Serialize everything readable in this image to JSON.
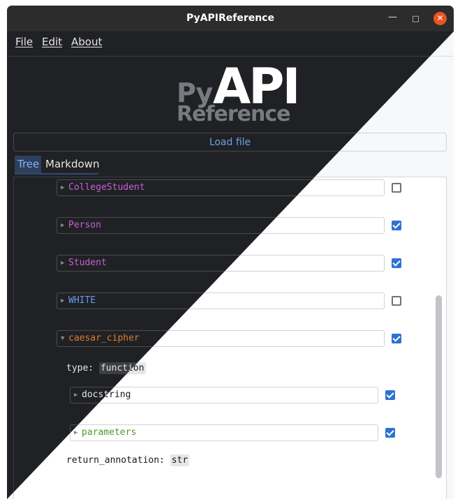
{
  "window": {
    "title": "PyAPIReference",
    "controls": {
      "minimize": "—",
      "maximize": "□",
      "close": "✕"
    }
  },
  "menu": {
    "items": [
      "File",
      "Edit",
      "About"
    ]
  },
  "logo": {
    "py": "Py",
    "api": "API",
    "reference": "Reference"
  },
  "load_button": "Load file",
  "tabs": {
    "active": "Tree",
    "items": [
      "Tree",
      "Markdown"
    ]
  },
  "tree": {
    "nodes": [
      {
        "label": "CollegeStudent",
        "kind": "class",
        "expanded": false,
        "checked": false
      },
      {
        "label": "Person",
        "kind": "class",
        "expanded": false,
        "checked": true
      },
      {
        "label": "Student",
        "kind": "class",
        "expanded": false,
        "checked": true
      },
      {
        "label": "WHITE",
        "kind": "constant",
        "expanded": false,
        "checked": false
      },
      {
        "label": "caesar_cipher",
        "kind": "function",
        "expanded": true,
        "checked": true
      }
    ],
    "caesar_cipher": {
      "type_key": "type:",
      "type_value": "function",
      "children": [
        {
          "label": "docstring",
          "expanded": false,
          "checked": true
        },
        {
          "label": "parameters",
          "expanded": false,
          "checked": true
        }
      ],
      "return_key": "return_annotation:",
      "return_value": "str"
    }
  },
  "colors": {
    "accent": "#2d72d2",
    "class": "#b63bc6",
    "constant": "#4d7fdc",
    "function": "#d4691a",
    "parameters": "#4a9a2a",
    "close_button": "#e95420"
  },
  "icons": {
    "collapsed": "triangle-right-icon",
    "expanded": "triangle-down-icon",
    "checkbox_on": "checkbox-checked-icon",
    "checkbox_off": "checkbox-empty-icon"
  }
}
